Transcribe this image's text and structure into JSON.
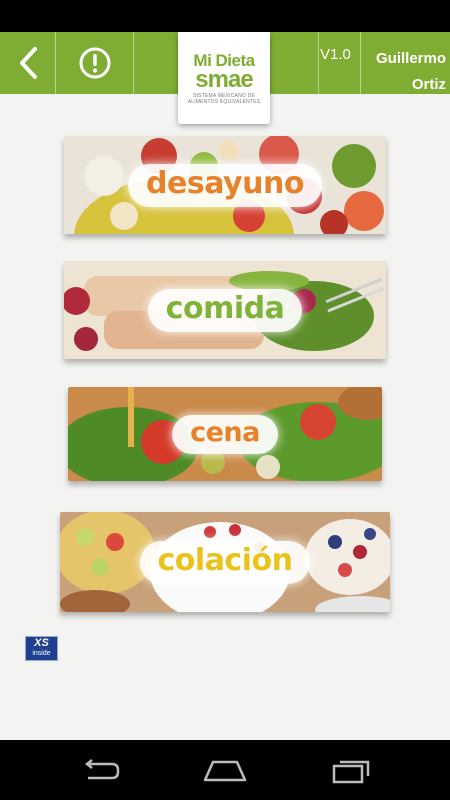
{
  "header": {
    "back_icon": "chevron-left-icon",
    "alert_icon": "exclamation-circle-icon",
    "logo_line1": "Mi Dieta",
    "logo_line2": "smae",
    "logo_subtitle": "SISTEMA MEXICANO DE ALIMENTOS EQUIVALENTES",
    "version": "V1.0",
    "user_first": "Guillermo",
    "user_last": "Ortiz",
    "bar_color": "#7fad33"
  },
  "meals": [
    {
      "label": "desayuno",
      "color": "#e8822a"
    },
    {
      "label": "comida",
      "color": "#7fb33a"
    },
    {
      "label": "cena",
      "color": "#e8822a"
    },
    {
      "label": "colación",
      "color": "#e9c21a"
    }
  ],
  "badge": {
    "line1": "XS",
    "line2": "inside"
  },
  "nav": {
    "back_icon": "back-arrow-icon",
    "home_icon": "home-icon",
    "recents_icon": "recent-apps-icon"
  }
}
